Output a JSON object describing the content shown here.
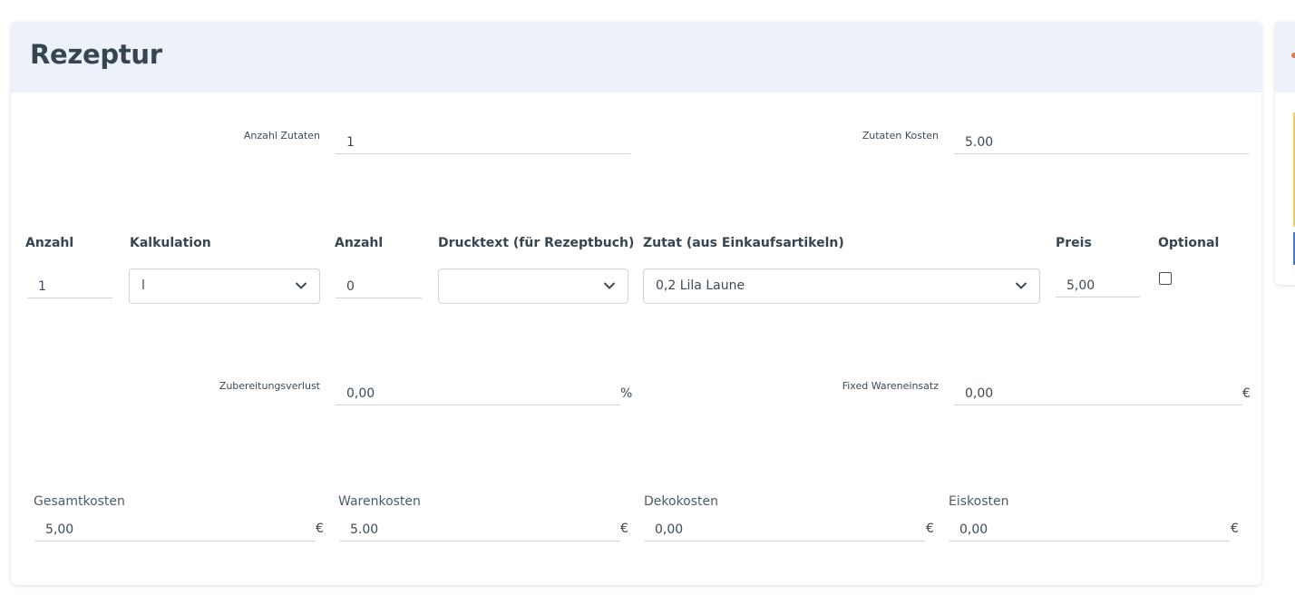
{
  "card": {
    "title": "Rezeptur"
  },
  "summary": {
    "anzahl_zutaten_label": "Anzahl Zutaten",
    "anzahl_zutaten_value": "1",
    "zutaten_kosten_label": "Zutaten Kosten",
    "zutaten_kosten_value": "5.00"
  },
  "table": {
    "headers": [
      "Anzahl",
      "Kalkulation",
      "Anzahl",
      "Drucktext (für Rezeptbuch)",
      "Zutat (aus Einkaufsartikeln)",
      "Preis",
      "Optional"
    ],
    "row": {
      "anzahl": "1",
      "kalkulation": "l",
      "anzahl2": "0",
      "drucktext": "",
      "zutat": "0,2 Lila Laune",
      "preis": "5,00",
      "optional_checked": false
    }
  },
  "loss": {
    "zubereitungsverlust_label": "Zubereitungsverlust",
    "zubereitungsverlust_value": "0,00",
    "zubereitungsverlust_unit": "%",
    "fixed_label": "Fixed Wareneinsatz",
    "fixed_value": "0,00",
    "fixed_unit": "€"
  },
  "costs": [
    {
      "label": "Gesamtkosten",
      "value": "5,00",
      "unit": "€"
    },
    {
      "label": "Warenkosten",
      "value": "5.00",
      "unit": "€"
    },
    {
      "label": "Dekokosten",
      "value": "0,00",
      "unit": "€"
    },
    {
      "label": "Eiskosten",
      "value": "0,00",
      "unit": "€"
    }
  ],
  "icons": {
    "select_chevron": "chevron-down-icon"
  },
  "colors": {
    "header_bg": "#edf1fa",
    "text": "#3b4a57",
    "border": "#cfd6dd"
  }
}
